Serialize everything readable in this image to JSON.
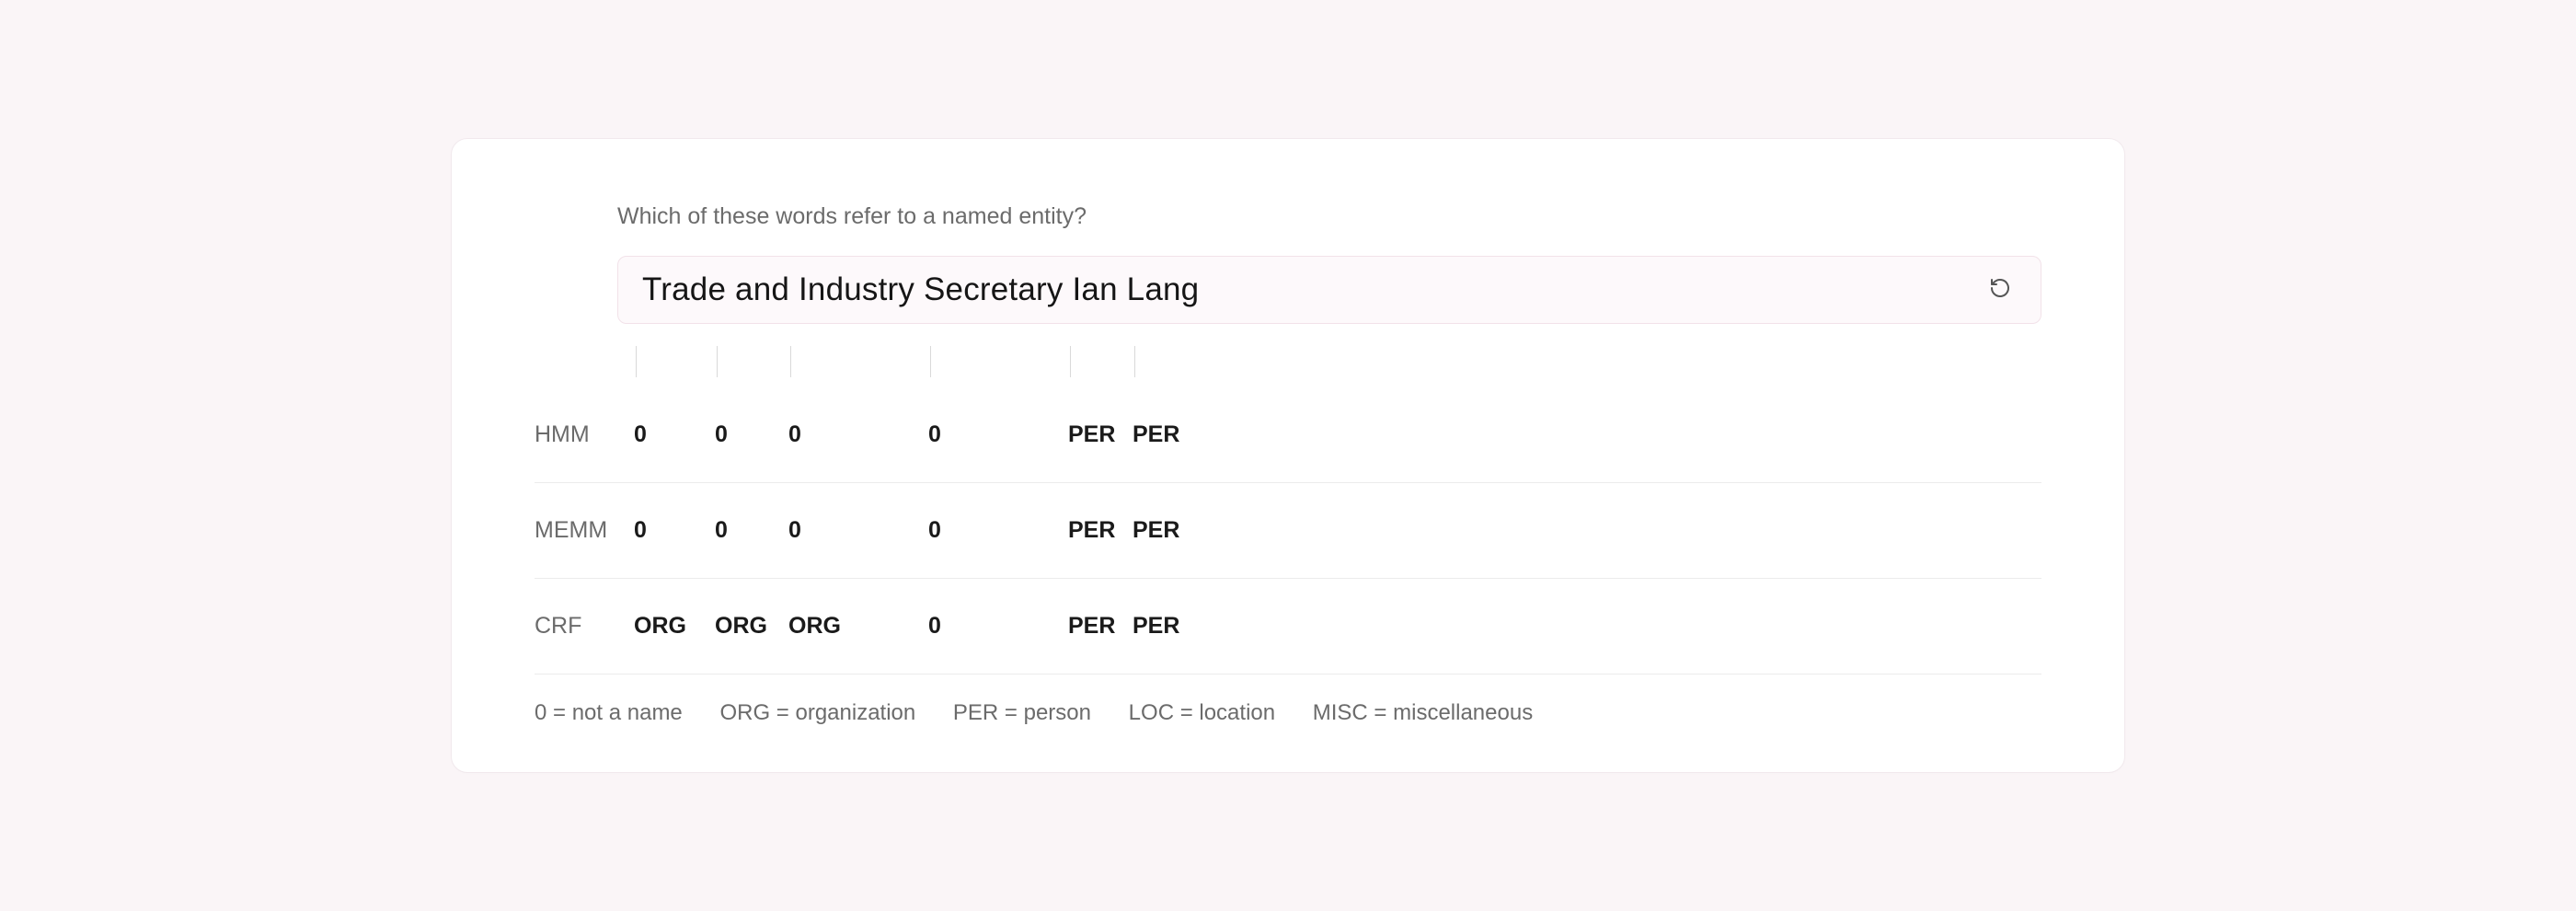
{
  "prompt": "Which of these words refer to a named entity?",
  "sentence": "Trade and Industry Secretary Ian Lang",
  "tokens": [
    "Trade",
    "and",
    "Industry",
    "Secretary",
    "Ian",
    "Lang"
  ],
  "models": [
    {
      "name": "HMM",
      "tags": [
        "0",
        "0",
        "0",
        "0",
        "PER",
        "PER"
      ]
    },
    {
      "name": "MEMM",
      "tags": [
        "0",
        "0",
        "0",
        "0",
        "PER",
        "PER"
      ]
    },
    {
      "name": "CRF",
      "tags": [
        "ORG",
        "ORG",
        "ORG",
        "0",
        "PER",
        "PER"
      ]
    }
  ],
  "legend": [
    "0 = not a name",
    "ORG = organization",
    "PER = person",
    "LOC = location",
    "MISC = miscellaneous"
  ]
}
